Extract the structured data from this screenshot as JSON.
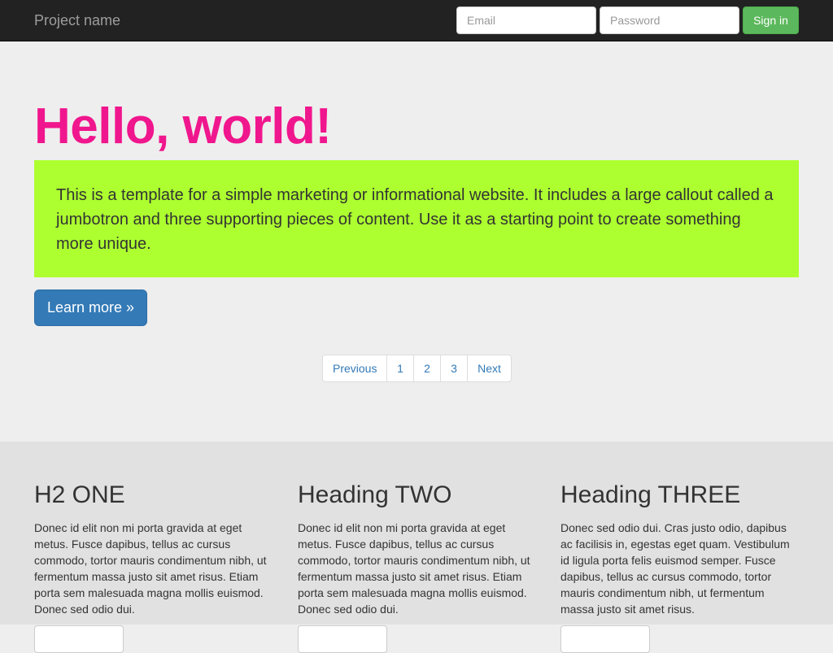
{
  "navbar": {
    "brand": "Project name",
    "email_placeholder": "Email",
    "password_placeholder": "Password",
    "signin_label": "Sign in",
    "background_color": "#222222",
    "signin_color": "#5cb85c"
  },
  "jumbotron": {
    "title": "Hello, world!",
    "title_color": "#f0168d",
    "callout_text": "This is a template for a simple marketing or informational website. It includes a large callout called a jumbotron and three supporting pieces of content. Use it as a starting point to create something more unique.",
    "callout_color": "#adff2f",
    "learn_more_label": "Learn more »",
    "learn_more_color": "#337ab7"
  },
  "pagination": {
    "previous": "Previous",
    "pages": [
      "1",
      "2",
      "3"
    ],
    "next": "Next"
  },
  "columns": [
    {
      "heading": "H2 ONE",
      "body": "Donec id elit non mi porta gravida at eget metus. Fusce dapibus, tellus ac cursus commodo, tortor mauris condimentum nibh, ut fermentum massa justo sit amet risus. Etiam porta sem malesuada magna mollis euismod. Donec sed odio dui."
    },
    {
      "heading": "Heading TWO",
      "body": "Donec id elit non mi porta gravida at eget metus. Fusce dapibus, tellus ac cursus commodo, tortor mauris condimentum nibh, ut fermentum massa justo sit amet risus. Etiam porta sem malesuada magna mollis euismod. Donec sed odio dui."
    },
    {
      "heading": "Heading THREE",
      "body": "Donec sed odio dui. Cras justo odio, dapibus ac facilisis in, egestas eget quam. Vestibulum id ligula porta felis euismod semper. Fusce dapibus, tellus ac cursus commodo, tortor mauris condimentum nibh, ut fermentum massa justo sit amet risus."
    }
  ]
}
